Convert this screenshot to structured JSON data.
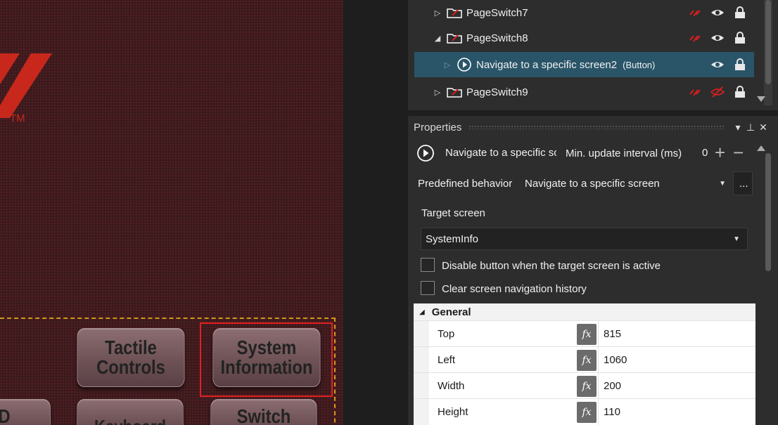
{
  "canvas": {
    "trademark": "TM",
    "buttons": [
      {
        "label": "Tactile\nControls"
      },
      {
        "label": "System\nInformation"
      },
      {
        "label": "RD"
      },
      {
        "label": "Keyboard"
      },
      {
        "label": "Switch"
      }
    ]
  },
  "tree": {
    "rows": [
      {
        "label": "PageSwitch7",
        "type": "",
        "expander": "▷"
      },
      {
        "label": "PageSwitch8",
        "type": "",
        "expander": "◢"
      },
      {
        "label": "Navigate to a specific screen2",
        "type": "(Button)",
        "expander": "▷"
      },
      {
        "label": "PageSwitch9",
        "type": "",
        "expander": "▷"
      }
    ]
  },
  "properties": {
    "title": "Properties",
    "object_name": "Navigate to a specific sc",
    "min_update_label": "Min. update interval (ms)",
    "min_update_value": "0",
    "predefined_behavior_label": "Predefined behavior",
    "predefined_behavior_value": "Navigate to a specific screen",
    "ellipsis_label": "...",
    "target_screen_label": "Target screen",
    "target_screen_value": "SystemInfo",
    "disable_button_label": "Disable button when the target screen is active",
    "clear_history_label": "Clear screen navigation history",
    "general_label": "General",
    "general_rows": [
      {
        "name": "Top",
        "value": "815"
      },
      {
        "name": "Left",
        "value": "1060"
      },
      {
        "name": "Width",
        "value": "200"
      },
      {
        "name": "Height",
        "value": "110"
      }
    ],
    "fx_label": "fx"
  },
  "colors": {
    "selected_row": "#2a5569",
    "link_red": "#d42020",
    "canvas_bg": "#3a1a1d",
    "logo_red": "#c8281c"
  }
}
